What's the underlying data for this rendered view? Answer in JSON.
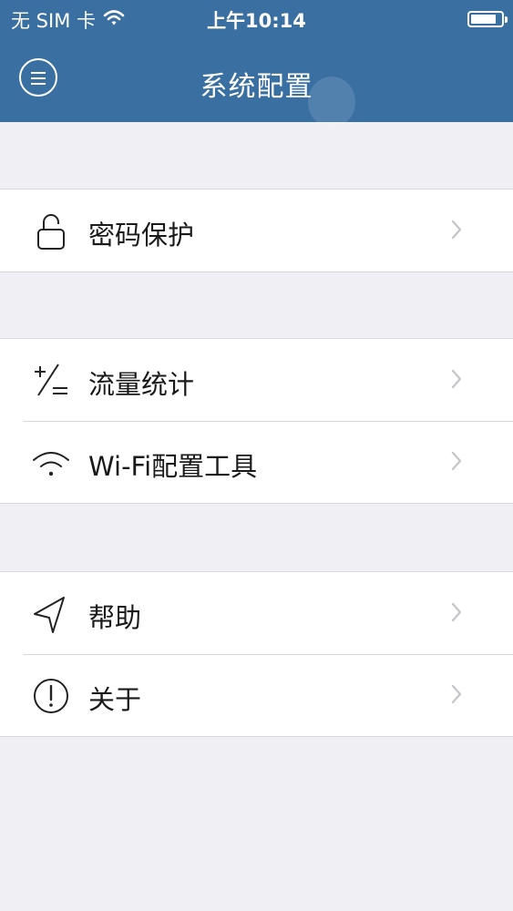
{
  "status_bar": {
    "carrier": "无 SIM 卡",
    "time": "上午10:14",
    "battery_level": 0.85
  },
  "nav": {
    "title": "系统配置"
  },
  "groups": [
    {
      "items": [
        {
          "label": "密码保护",
          "icon": "lock-icon"
        }
      ]
    },
    {
      "items": [
        {
          "label": "流量统计",
          "icon": "plus-minus-icon"
        },
        {
          "label": "Wi-Fi配置工具",
          "icon": "wifi-icon"
        }
      ]
    },
    {
      "items": [
        {
          "label": "帮助",
          "icon": "location-arrow-icon"
        },
        {
          "label": "关于",
          "icon": "info-exclamation-icon"
        }
      ]
    }
  ],
  "colors": {
    "header_bg": "#3a6fa1",
    "page_bg": "#efeff4",
    "chevron": "#c7c7cc"
  }
}
